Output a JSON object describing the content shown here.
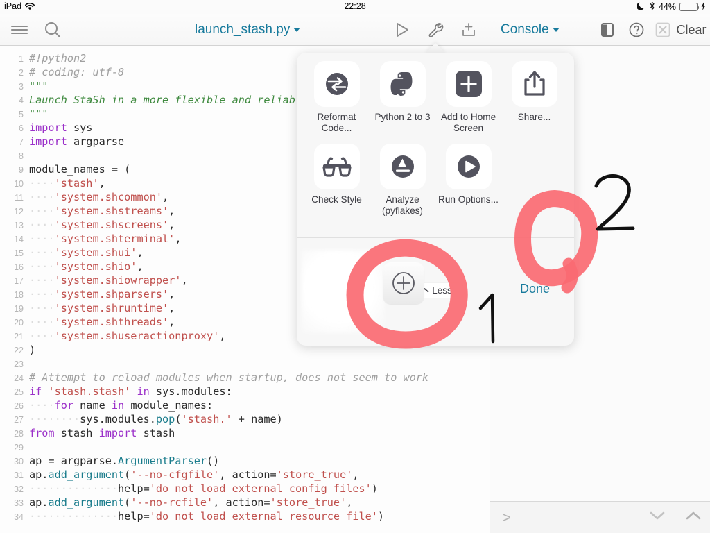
{
  "statusbar": {
    "device": "iPad",
    "wifi_icon": "wifi-icon",
    "time": "22:28",
    "dnd_icon": "moon-icon",
    "bluetooth_icon": "bluetooth-icon",
    "battery_percent": "44%",
    "battery_fill_color": "#4cd750",
    "charging_icon": "lightning-bolt-icon"
  },
  "toolbar": {
    "menu_icon": "hamburger-menu-icon",
    "search_icon": "search-icon",
    "file_title": "launch_stash.py",
    "file_title_caret": "chevron-down-icon",
    "run_icon": "play-triangle-icon",
    "tools_icon": "wrench-icon",
    "share_sheet_icon": "add-to-tray-icon",
    "console_title": "Console",
    "console_caret": "chevron-down-icon",
    "panel_icon": "split-panel-icon",
    "help_icon": "question-mark-circle-icon",
    "stop_icon": "x-box-icon",
    "clear_label": "Clear",
    "accent_color": "#177a9c"
  },
  "console": {
    "info_icon": "info-circle-icon",
    "prompt": ">",
    "down_icon": "chevron-down-icon",
    "up_icon": "chevron-up-icon"
  },
  "popover": {
    "row1": [
      {
        "label": "Reformat Code...",
        "icon": "reformat-code-icon"
      },
      {
        "label": "Python 2 to 3",
        "icon": "python-logo-icon"
      },
      {
        "label": "Add to Home Screen",
        "icon": "plus-square-icon"
      },
      {
        "label": "Share...",
        "icon": "share-upload-icon"
      }
    ],
    "row2": [
      {
        "label": "Check Style",
        "icon": "glasses-icon"
      },
      {
        "label": "Analyze (pyflakes)",
        "icon": "gauge-icon"
      },
      {
        "label": "Run Options...",
        "icon": "play-circle-icon"
      }
    ],
    "less_label": "Less",
    "less_caret": "chevron-up-icon",
    "add_action_icon": "plus-circle-icon",
    "done_label": "Done"
  },
  "annotations": {
    "mark_one": "1",
    "mark_two": "2",
    "circle_color": "#fa6a72",
    "pen_color": "#111111"
  },
  "code": {
    "lines": [
      {
        "n": "1",
        "tokens": [
          {
            "t": "#!python2",
            "c": "c-com"
          }
        ]
      },
      {
        "n": "2",
        "tokens": [
          {
            "t": "# coding: utf-8",
            "c": "c-com"
          }
        ]
      },
      {
        "n": "3",
        "tokens": [
          {
            "t": "\"\"\"",
            "c": "c-docq"
          }
        ]
      },
      {
        "n": "4",
        "tokens": [
          {
            "t": "Launch StaSh in a more flexible and reliable way",
            "c": "c-doc"
          }
        ]
      },
      {
        "n": "5",
        "tokens": [
          {
            "t": "\"\"\"",
            "c": "c-docq"
          }
        ]
      },
      {
        "n": "6",
        "tokens": [
          {
            "t": "import",
            "c": "c-kw"
          },
          {
            "t": " sys",
            "c": "c-txt"
          }
        ]
      },
      {
        "n": "7",
        "tokens": [
          {
            "t": "import",
            "c": "c-kw"
          },
          {
            "t": " argparse",
            "c": "c-txt"
          }
        ]
      },
      {
        "n": "8",
        "tokens": []
      },
      {
        "n": "9",
        "tokens": [
          {
            "t": "module_names = (",
            "c": "c-txt"
          }
        ]
      },
      {
        "n": "10",
        "tokens": [
          {
            "t": "····",
            "c": "c-ind"
          },
          {
            "t": "'stash'",
            "c": "c-str"
          },
          {
            "t": ",",
            "c": "c-txt"
          }
        ]
      },
      {
        "n": "11",
        "tokens": [
          {
            "t": "····",
            "c": "c-ind"
          },
          {
            "t": "'system.shcommon'",
            "c": "c-str"
          },
          {
            "t": ",",
            "c": "c-txt"
          }
        ]
      },
      {
        "n": "12",
        "tokens": [
          {
            "t": "····",
            "c": "c-ind"
          },
          {
            "t": "'system.shstreams'",
            "c": "c-str"
          },
          {
            "t": ",",
            "c": "c-txt"
          }
        ]
      },
      {
        "n": "13",
        "tokens": [
          {
            "t": "····",
            "c": "c-ind"
          },
          {
            "t": "'system.shscreens'",
            "c": "c-str"
          },
          {
            "t": ",",
            "c": "c-txt"
          }
        ]
      },
      {
        "n": "14",
        "tokens": [
          {
            "t": "····",
            "c": "c-ind"
          },
          {
            "t": "'system.shterminal'",
            "c": "c-str"
          },
          {
            "t": ",",
            "c": "c-txt"
          }
        ]
      },
      {
        "n": "15",
        "tokens": [
          {
            "t": "····",
            "c": "c-ind"
          },
          {
            "t": "'system.shui'",
            "c": "c-str"
          },
          {
            "t": ",",
            "c": "c-txt"
          }
        ]
      },
      {
        "n": "16",
        "tokens": [
          {
            "t": "····",
            "c": "c-ind"
          },
          {
            "t": "'system.shio'",
            "c": "c-str"
          },
          {
            "t": ",",
            "c": "c-txt"
          }
        ]
      },
      {
        "n": "17",
        "tokens": [
          {
            "t": "····",
            "c": "c-ind"
          },
          {
            "t": "'system.shiowrapper'",
            "c": "c-str"
          },
          {
            "t": ",",
            "c": "c-txt"
          }
        ]
      },
      {
        "n": "18",
        "tokens": [
          {
            "t": "····",
            "c": "c-ind"
          },
          {
            "t": "'system.shparsers'",
            "c": "c-str"
          },
          {
            "t": ",",
            "c": "c-txt"
          }
        ]
      },
      {
        "n": "19",
        "tokens": [
          {
            "t": "····",
            "c": "c-ind"
          },
          {
            "t": "'system.shruntime'",
            "c": "c-str"
          },
          {
            "t": ",",
            "c": "c-txt"
          }
        ]
      },
      {
        "n": "20",
        "tokens": [
          {
            "t": "····",
            "c": "c-ind"
          },
          {
            "t": "'system.shthreads'",
            "c": "c-str"
          },
          {
            "t": ",",
            "c": "c-txt"
          }
        ]
      },
      {
        "n": "21",
        "tokens": [
          {
            "t": "····",
            "c": "c-ind"
          },
          {
            "t": "'system.shuseractionproxy'",
            "c": "c-str"
          },
          {
            "t": ",",
            "c": "c-txt"
          }
        ]
      },
      {
        "n": "22",
        "tokens": [
          {
            "t": ")",
            "c": "c-txt"
          }
        ]
      },
      {
        "n": "23",
        "tokens": []
      },
      {
        "n": "24",
        "tokens": [
          {
            "t": "# Attempt to reload modules when startup, does not seem to work",
            "c": "c-com"
          }
        ]
      },
      {
        "n": "25",
        "tokens": [
          {
            "t": "if",
            "c": "c-kw"
          },
          {
            "t": " ",
            "c": "c-txt"
          },
          {
            "t": "'stash.stash'",
            "c": "c-str"
          },
          {
            "t": " ",
            "c": "c-txt"
          },
          {
            "t": "in",
            "c": "c-kw"
          },
          {
            "t": " sys.modules:",
            "c": "c-txt"
          }
        ]
      },
      {
        "n": "26",
        "tokens": [
          {
            "t": "····",
            "c": "c-ind"
          },
          {
            "t": "for",
            "c": "c-kw"
          },
          {
            "t": " name ",
            "c": "c-txt"
          },
          {
            "t": "in",
            "c": "c-kw"
          },
          {
            "t": " module_names:",
            "c": "c-txt"
          }
        ]
      },
      {
        "n": "27",
        "tokens": [
          {
            "t": "········",
            "c": "c-ind"
          },
          {
            "t": "sys.modules.",
            "c": "c-txt"
          },
          {
            "t": "pop",
            "c": "c-fn"
          },
          {
            "t": "(",
            "c": "c-txt"
          },
          {
            "t": "'stash.'",
            "c": "c-str"
          },
          {
            "t": " + name)",
            "c": "c-txt"
          }
        ]
      },
      {
        "n": "28",
        "tokens": [
          {
            "t": "from",
            "c": "c-kw"
          },
          {
            "t": " stash ",
            "c": "c-txt"
          },
          {
            "t": "import",
            "c": "c-kw"
          },
          {
            "t": " stash",
            "c": "c-txt"
          }
        ]
      },
      {
        "n": "29",
        "tokens": []
      },
      {
        "n": "30",
        "tokens": [
          {
            "t": "ap = argparse.",
            "c": "c-txt"
          },
          {
            "t": "ArgumentParser",
            "c": "c-fn"
          },
          {
            "t": "()",
            "c": "c-txt"
          }
        ]
      },
      {
        "n": "31",
        "tokens": [
          {
            "t": "ap.",
            "c": "c-txt"
          },
          {
            "t": "add_argument",
            "c": "c-fn"
          },
          {
            "t": "(",
            "c": "c-txt"
          },
          {
            "t": "'--no-cfgfile'",
            "c": "c-str"
          },
          {
            "t": ", action=",
            "c": "c-txt"
          },
          {
            "t": "'store_true'",
            "c": "c-str"
          },
          {
            "t": ",",
            "c": "c-txt"
          }
        ]
      },
      {
        "n": "32",
        "tokens": [
          {
            "t": "··············",
            "c": "c-ind"
          },
          {
            "t": "help=",
            "c": "c-txt"
          },
          {
            "t": "'do not load external config files'",
            "c": "c-str"
          },
          {
            "t": ")",
            "c": "c-txt"
          }
        ]
      },
      {
        "n": "33",
        "tokens": [
          {
            "t": "ap.",
            "c": "c-txt"
          },
          {
            "t": "add_argument",
            "c": "c-fn"
          },
          {
            "t": "(",
            "c": "c-txt"
          },
          {
            "t": "'--no-rcfile'",
            "c": "c-str"
          },
          {
            "t": ", action=",
            "c": "c-txt"
          },
          {
            "t": "'store_true'",
            "c": "c-str"
          },
          {
            "t": ",",
            "c": "c-txt"
          }
        ]
      },
      {
        "n": "34",
        "tokens": [
          {
            "t": "··············",
            "c": "c-ind"
          },
          {
            "t": "help=",
            "c": "c-txt"
          },
          {
            "t": "'do not load external resource file'",
            "c": "c-str"
          },
          {
            "t": ")",
            "c": "c-txt"
          }
        ]
      }
    ]
  }
}
